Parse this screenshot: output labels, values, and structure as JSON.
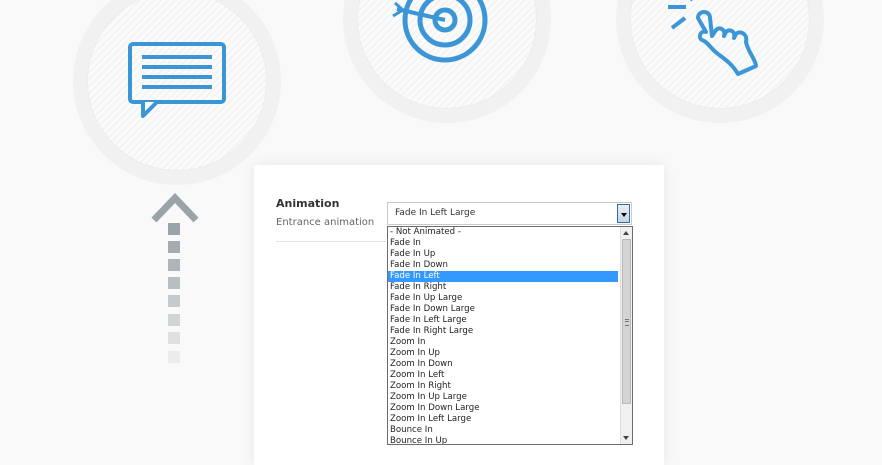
{
  "field": {
    "title": "Animation",
    "subtitle": "Entrance animation",
    "selected_value": "Fade In Left Large"
  },
  "dropdown": {
    "options": [
      "- Not Animated -",
      "Fade In",
      "Fade In Up",
      "Fade In Down",
      "Fade In Left",
      "Fade In Right",
      "Fade In Up Large",
      "Fade In Down Large",
      "Fade In Left Large",
      "Fade In Right Large",
      "Zoom In",
      "Zoom In Up",
      "Zoom In Down",
      "Zoom In Left",
      "Zoom In Right",
      "Zoom In Up Large",
      "Zoom In Down Large",
      "Zoom In Left Large",
      "Bounce In",
      "Bounce In Up"
    ],
    "highlighted_index": 4
  },
  "icons": {
    "left": "chat-message-icon",
    "center": "target-icon",
    "right": "tap-hand-icon"
  },
  "colors": {
    "icon_blue": "#3a96d6",
    "highlight": "#3399ff",
    "arrow_gray": "#9aa3a7"
  }
}
